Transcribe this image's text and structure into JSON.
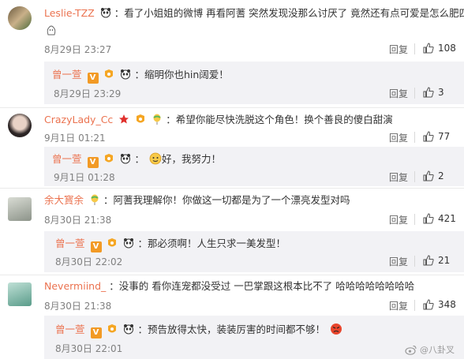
{
  "ui": {
    "reply_label": "回复"
  },
  "comments": [
    {
      "user": "Leslie-TZZ",
      "text": "看了小姐姐的微博 再看阿蓍 突然发现没那么讨厌了 竟然还有点可爱是怎么肥四",
      "line1": "看了小姐姐的微博 再看阿蓍 突然发现没那么讨厌了 竟然还有点可爱是怎么肥四",
      "time": "8月29日 23:27",
      "likes": "108",
      "reply": {
        "user": "曾一萱",
        "text": "缩明你也hin阔爱！",
        "time": "8月29日 23:29",
        "likes": "3"
      }
    },
    {
      "user": "CrazyLady_Cc",
      "text": "希望你能尽快洗脱这个角色！换个善良的傻白甜演",
      "time": "9月1日 01:21",
      "likes": "77",
      "reply": {
        "user": "曾一萱",
        "text": "好，我努力！",
        "time": "9月1日 01:28",
        "likes": "2"
      }
    },
    {
      "user": "余大寳余",
      "text": "阿蓍我理解你！你做这一切都是为了一个漂亮发型对吗",
      "time": "8月30日 21:38",
      "likes": "421",
      "reply": {
        "user": "曾一萱",
        "text": "那必须啊！人生只求一美发型！",
        "time": "8月30日 22:02",
        "likes": "21"
      }
    },
    {
      "user": "Nevermiind_",
      "text": "没事的 看你连宠都没受过 一巴掌跟这根本比不了 哈哈哈哈哈哈哈哈",
      "time": "8月30日 21:38",
      "likes": "348",
      "reply": {
        "user": "曾一萱",
        "text": "预告放得太快，装装厉害的时间都不够！",
        "time": "8月30日 22:01",
        "likes": ""
      }
    }
  ],
  "watermark": "@八卦叉"
}
